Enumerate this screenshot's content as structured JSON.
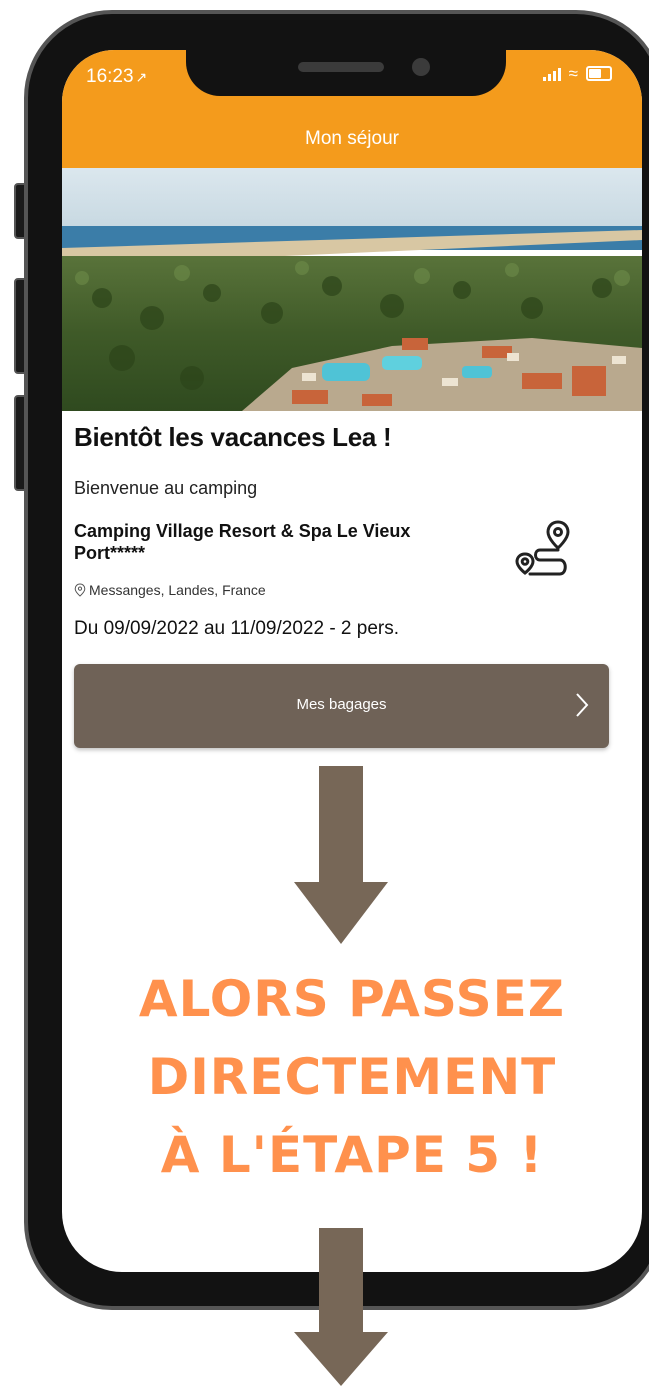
{
  "status_bar": {
    "time": "16:23",
    "location_arrow": "↗"
  },
  "header": {
    "title": "Mon séjour",
    "background_color": "#f49b1c"
  },
  "hero": {
    "icon": "campsite-aerial-photo"
  },
  "stay": {
    "greeting": "Bientôt les vacances Lea !",
    "welcome": "Bienvenue au camping",
    "camping_name": "Camping Village Resort & Spa Le Vieux Port*****",
    "location": "Messanges, Landes, France",
    "dates": "Du 09/09/2022 au 11/09/2022 - 2 pers."
  },
  "buttons": {
    "luggage_label": "Mes bagages",
    "luggage_color": "#6f6257"
  },
  "overlay": {
    "message_line1": "ALORS PASSEZ",
    "message_line2": "DIRECTEMENT",
    "message_line3": "À L'ÉTAPE 5 !",
    "message_color": "#ff914d",
    "arrow_color": "#776757"
  }
}
